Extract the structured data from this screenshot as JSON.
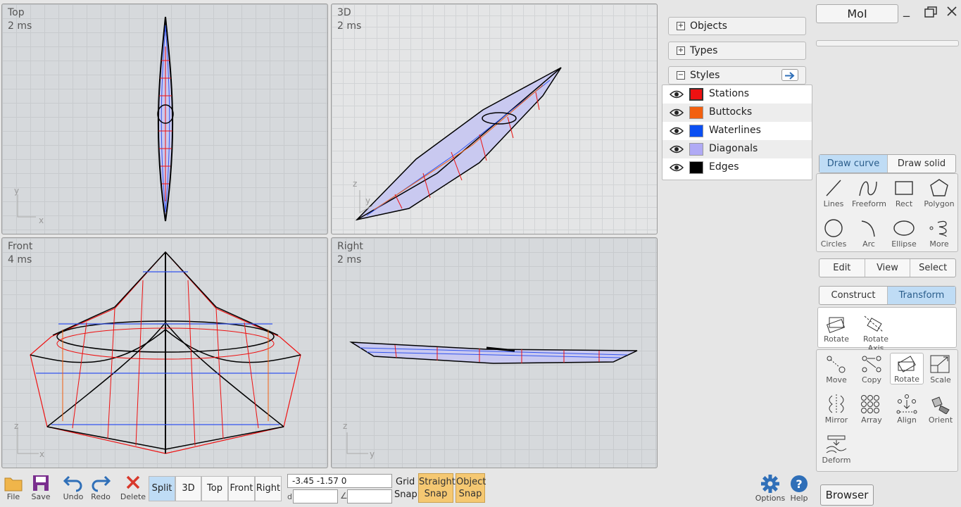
{
  "viewports": {
    "top": {
      "name": "Top",
      "time": "2 ms",
      "axis_a": "y",
      "axis_b": "x"
    },
    "threed": {
      "name": "3D",
      "time": "2 ms",
      "axis_a": "z",
      "axis_b": "y"
    },
    "front": {
      "name": "Front",
      "time": "4 ms",
      "axis_a": "z",
      "axis_b": "x"
    },
    "right": {
      "name": "Right",
      "time": "2 ms",
      "axis_a": "z",
      "axis_b": "y"
    }
  },
  "panel": {
    "objects": "Objects",
    "types": "Types",
    "styles": "Styles",
    "style_items": [
      {
        "label": "Stations",
        "color": "#ee1111"
      },
      {
        "label": "Buttocks",
        "color": "#f2600f"
      },
      {
        "label": "Waterlines",
        "color": "#0b4ff2"
      },
      {
        "label": "Diagonals",
        "color": "#b0aaf5"
      },
      {
        "label": "Edges",
        "color": "#000000"
      }
    ]
  },
  "app": {
    "title": "MoI"
  },
  "draw_tabs": [
    "Draw curve",
    "Draw solid"
  ],
  "draw_tools": [
    "Lines",
    "Freeform",
    "Rect",
    "Polygon",
    "Circles",
    "Arc",
    "Ellipse",
    "More"
  ],
  "mid_tabs": [
    "Edit",
    "View",
    "Select"
  ],
  "tr_tabs": [
    "Construct",
    "Transform"
  ],
  "transform_top": [
    "Rotate",
    "Rotate Axis"
  ],
  "transform_tools": [
    "Move",
    "Copy",
    "Rotate",
    "Scale",
    "Mirror",
    "Array",
    "Align",
    "Orient",
    "Deform"
  ],
  "bottom": {
    "file": "File",
    "save": "Save",
    "undo": "Undo",
    "redo": "Redo",
    "delete": "Delete",
    "views": [
      "Split",
      "3D",
      "Top",
      "Front",
      "Right"
    ],
    "coords": "-3.45    -1.57     0",
    "d_label": "d",
    "angle_label": "∠",
    "grid": "Grid",
    "snap": "Snap",
    "straight_snap": [
      "Straight",
      "Snap"
    ],
    "object_snap": [
      "Object",
      "Snap"
    ],
    "options": "Options",
    "help": "Help",
    "browser": "Browser"
  },
  "colors": {
    "accent": "#bfdcf5",
    "snap": "#f5c872",
    "icon_blue": "#2f6fb8"
  }
}
